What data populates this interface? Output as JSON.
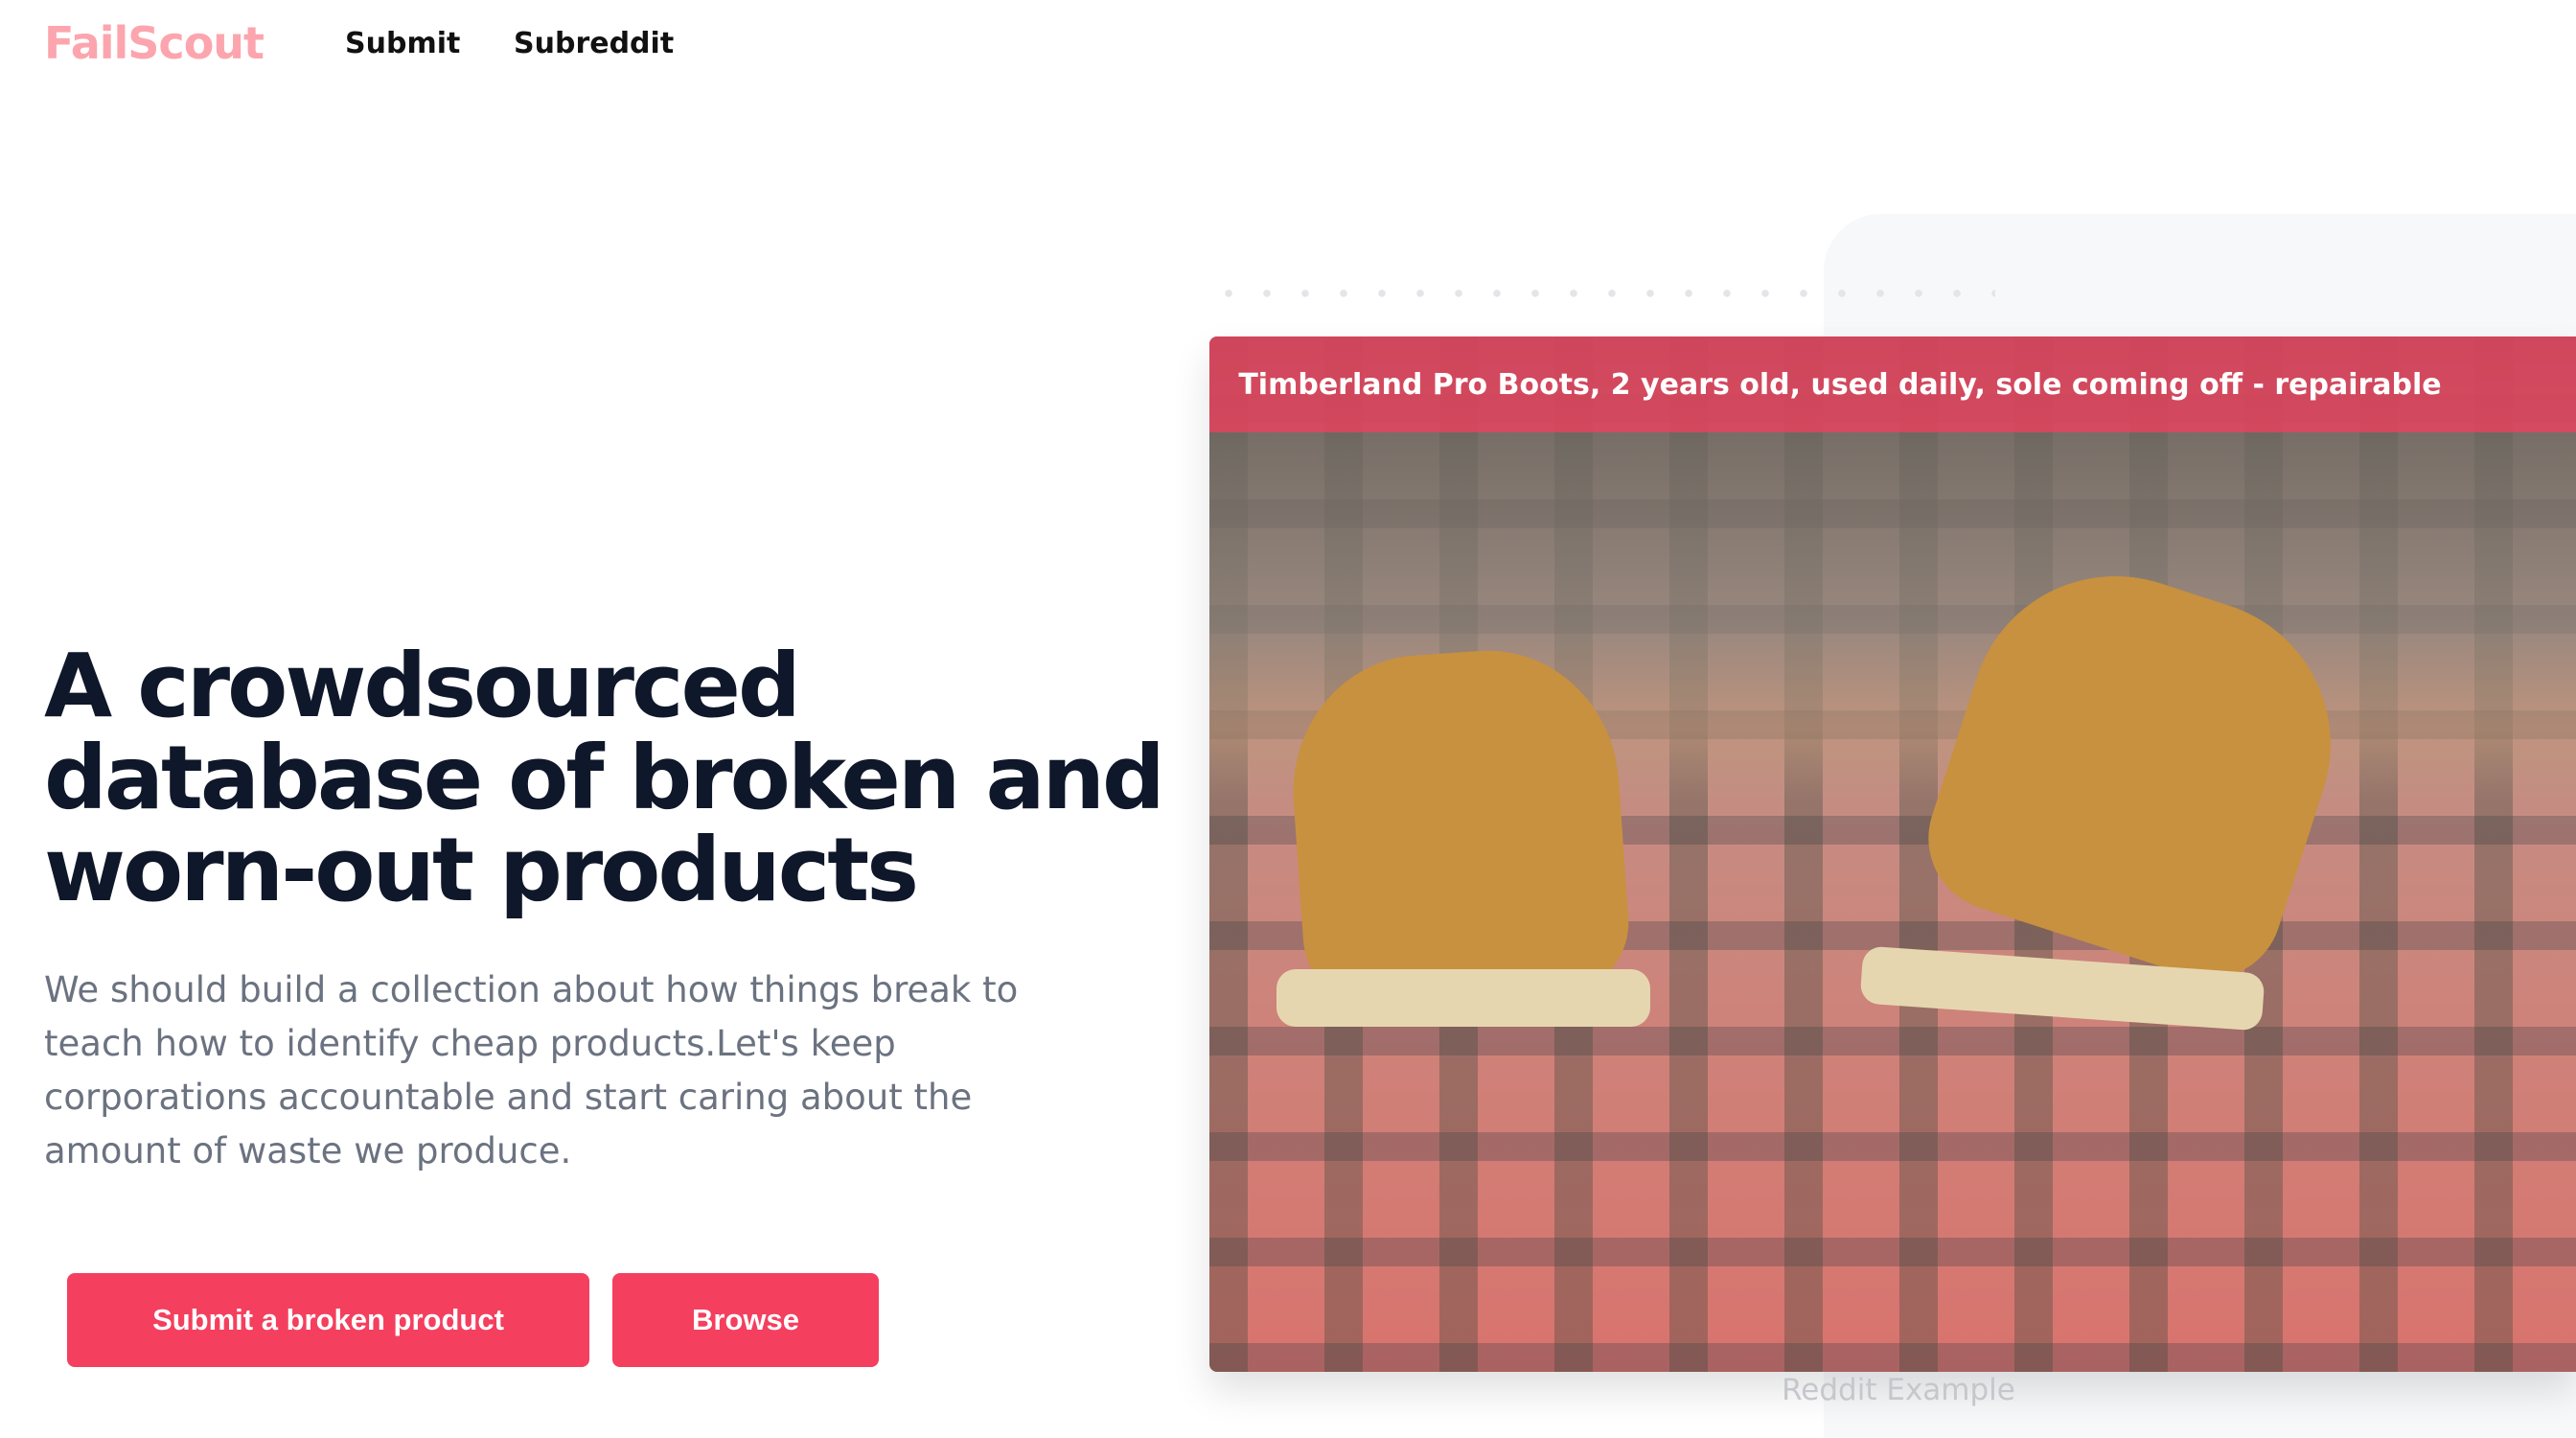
{
  "header": {
    "logo": "FailScout",
    "nav": [
      {
        "label": "Submit"
      },
      {
        "label": "Subreddit"
      }
    ]
  },
  "hero": {
    "title": "A crowdsourced database of broken and worn-out products",
    "description": "We should build a collection about how things break to teach how to identify cheap products.Let's keep corporations accountable and start caring about the amount of waste we produce.",
    "primary_button": "Submit a broken product",
    "secondary_button": "Browse"
  },
  "example": {
    "banner": "Timberland Pro Boots, 2 years old, used daily, sole coming off - repairable",
    "caption": "Reddit Example"
  },
  "colors": {
    "accent": "#f43f5e",
    "logo": "#fca5ae",
    "heading": "#0f172a",
    "body_text": "#6b7280"
  }
}
